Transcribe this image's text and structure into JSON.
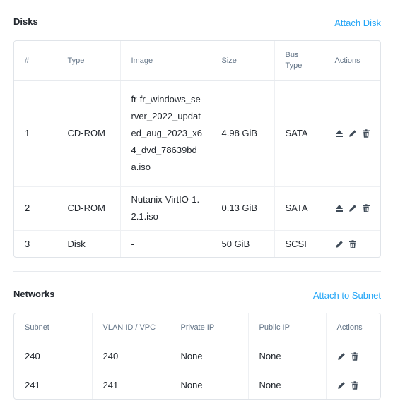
{
  "disks": {
    "title": "Disks",
    "attach_label": "Attach Disk",
    "columns": [
      "#",
      "Type",
      "Image",
      "Size",
      "Bus Type",
      "Actions"
    ],
    "rows": [
      {
        "num": "1",
        "type": "CD-ROM",
        "image": "fr-fr_windows_server_2022_updated_aug_2023_x64_dvd_78639bda.iso",
        "size": "4.98 GiB",
        "bus": "SATA",
        "actions": [
          "eject-icon",
          "edit-icon",
          "delete-icon"
        ]
      },
      {
        "num": "2",
        "type": "CD-ROM",
        "image": "Nutanix-VirtIO-1.2.1.iso",
        "size": "0.13 GiB",
        "bus": "SATA",
        "actions": [
          "eject-icon",
          "edit-icon",
          "delete-icon"
        ]
      },
      {
        "num": "3",
        "type": "Disk",
        "image": "-",
        "size": "50 GiB",
        "bus": "SCSI",
        "actions": [
          "edit-icon",
          "delete-icon"
        ]
      }
    ]
  },
  "networks": {
    "title": "Networks",
    "attach_label": "Attach to Subnet",
    "columns": [
      "Subnet",
      "VLAN ID / VPC",
      "Private IP",
      "Public IP",
      "Actions"
    ],
    "rows": [
      {
        "subnet": "240",
        "vlan": "240",
        "private_ip": "None",
        "public_ip": "None",
        "actions": [
          "edit-icon",
          "delete-icon"
        ]
      },
      {
        "subnet": "241",
        "vlan": "241",
        "private_ip": "None",
        "public_ip": "None",
        "actions": [
          "edit-icon",
          "delete-icon"
        ]
      }
    ]
  },
  "colors": {
    "link": "#22a5f7",
    "text": "#22272e",
    "header_text": "#627386",
    "icon": "#3f4b58",
    "border": "#e0e4e9"
  }
}
